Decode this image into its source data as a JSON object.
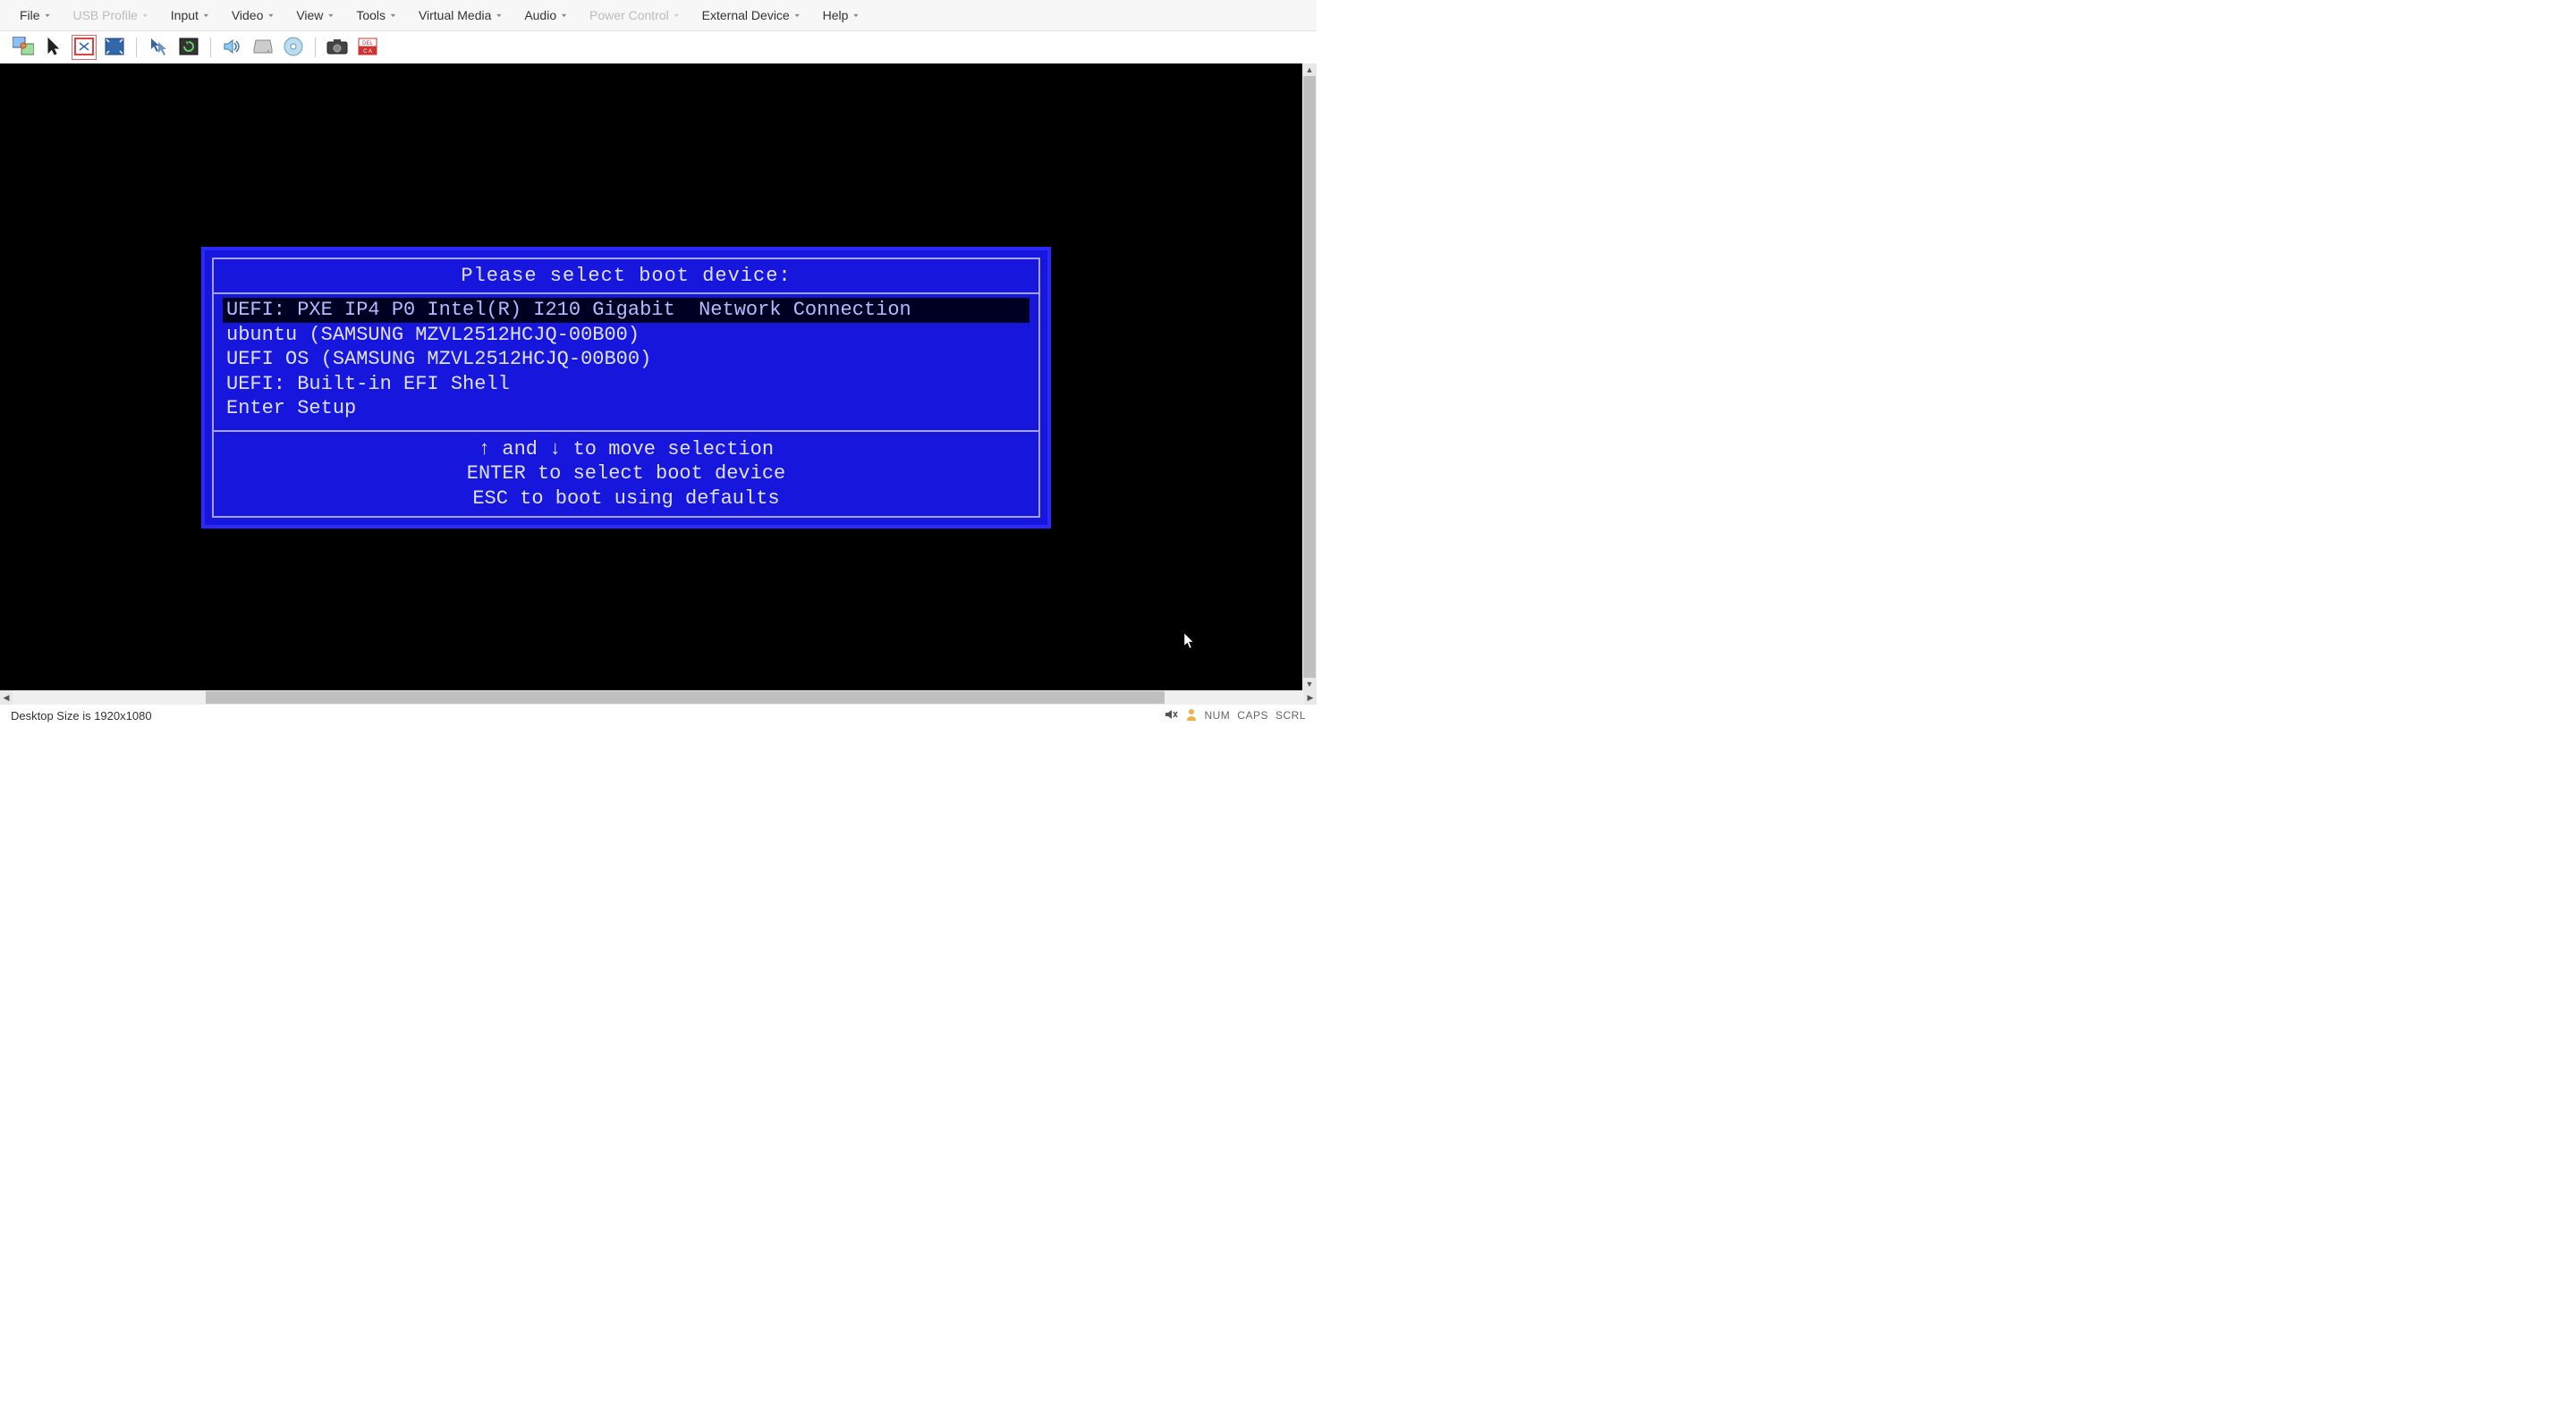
{
  "menu": {
    "file": "File",
    "usb_profile": "USB Profile",
    "input": "Input",
    "video": "Video",
    "view": "View",
    "tools": "Tools",
    "virtual_media": "Virtual Media",
    "audio": "Audio",
    "power_control": "Power Control",
    "external_device": "External Device",
    "help": "Help"
  },
  "toolbar_icons": {
    "connect": "connect",
    "cursor": "cursor",
    "fit": "fit-screen",
    "full": "fullscreen",
    "mouse_sync": "mouse-sync",
    "refresh": "refresh-video",
    "audio": "audio",
    "hdd": "hdd",
    "cd": "cd-dvd",
    "camera": "screenshot",
    "ctrl_alt_del": "ctrl-alt-del"
  },
  "boot_menu": {
    "title": "Please select boot device:",
    "options": [
      "UEFI: PXE IP4 P0 Intel(R) I210 Gigabit  Network Connection",
      "ubuntu (SAMSUNG MZVL2512HCJQ-00B00)",
      "UEFI OS (SAMSUNG MZVL2512HCJQ-00B00)",
      "UEFI: Built-in EFI Shell",
      "Enter Setup"
    ],
    "selected_index": 0,
    "help": {
      "line1": "↑ and ↓ to move selection",
      "line2": "ENTER to select boot device",
      "line3": "ESC to boot using defaults"
    }
  },
  "status": {
    "desktop_size": "Desktop Size is 1920x1080",
    "num": "NUM",
    "caps": "CAPS",
    "scrl": "SCRL"
  }
}
